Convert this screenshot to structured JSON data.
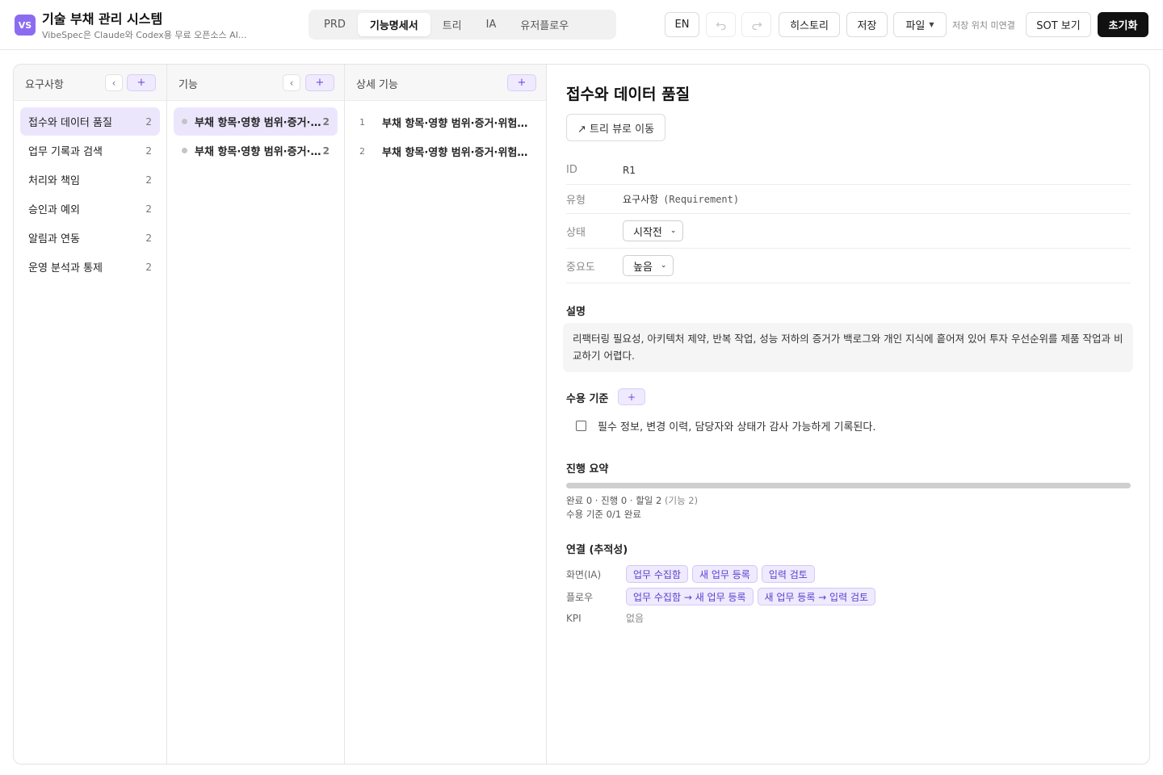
{
  "app": {
    "logo": "VS",
    "title": "기술 부채 관리 시스템",
    "subtitle": "VibeSpec은 Claude와 Codex용 무료 오픈소스 AI..."
  },
  "tabs": [
    {
      "label": "PRD",
      "active": false
    },
    {
      "label": "기능명세서",
      "active": true
    },
    {
      "label": "트리",
      "active": false
    },
    {
      "label": "IA",
      "active": false
    },
    {
      "label": "유저플로우",
      "active": false
    }
  ],
  "toolbar": {
    "lang": "EN",
    "undo_icon": "undo-icon",
    "redo_icon": "redo-icon",
    "history": "히스토리",
    "save": "저장",
    "file": "파일",
    "save_location": "저장 위치 미연결",
    "sot": "SOT 보기",
    "reset": "초기화"
  },
  "requirements": {
    "title": "요구사항",
    "collapse": "‹",
    "add": "+",
    "items": [
      {
        "label": "접수와 데이터 품질",
        "count": "2"
      },
      {
        "label": "업무 기록과 검색",
        "count": "2"
      },
      {
        "label": "처리와 책임",
        "count": "2"
      },
      {
        "label": "승인과 예외",
        "count": "2"
      },
      {
        "label": "알림과 연동",
        "count": "2"
      },
      {
        "label": "운영 분석과 통제",
        "count": "2"
      }
    ]
  },
  "features": {
    "title": "기능",
    "collapse": "‹",
    "add": "+",
    "items": [
      {
        "label": "부채 항목·영향 범위·증거·위험도 정리",
        "count": "2"
      },
      {
        "label": "부채 항목·영향 범위·증거·위험도 정리",
        "count": "2"
      }
    ]
  },
  "details": {
    "title": "상세 기능",
    "add": "+",
    "items": [
      {
        "num": "1",
        "label": "부채 항목·영향 범위·증거·위험도 정리"
      },
      {
        "num": "2",
        "label": "부채 항목·영향 범위·증거·위험도 정리"
      }
    ]
  },
  "detail": {
    "title": "접수와 데이터 품질",
    "tree_link": "↗ 트리 뷰로 이동",
    "props": {
      "id_key": "ID",
      "id_val": "R1",
      "type_key": "유형",
      "type_val": "요구사항",
      "type_en": "(Requirement)",
      "status_key": "상태",
      "status_val": "시작전",
      "priority_key": "중요도",
      "priority_val": "높음"
    },
    "desc_title": "설명",
    "desc": "리팩터링 필요성, 아키텍처 제약, 반복 작업, 성능 저하의 증거가 백로그와 개인 지식에 흩어져 있어 투자 우선순위를 제품 작업과 비교하기 어렵다.",
    "acceptance_title": "수용 기준",
    "acceptance_add": "+",
    "acceptance_items": [
      {
        "text": "필수 정보, 변경 이력, 담당자와 상태가 감사 가능하게 기록된다.",
        "checked": false
      }
    ],
    "progress_title": "진행 요약",
    "progress_fraction": 0,
    "progress_line1": "완료 0 · 진행 0 · 할일 2",
    "progress_line1_muted": "(기능 2)",
    "progress_line2": "수용 기준 0/1 완료",
    "links_title": "연결 (추적성)",
    "links": {
      "screens_key": "화면(IA)",
      "screens": [
        "업무 수집함",
        "새 업무 등록",
        "입력 검토"
      ],
      "flows_key": "플로우",
      "flows": [
        "업무 수집함 → 새 업무 등록",
        "새 업무 등록 → 입력 검토"
      ],
      "kpi_key": "KPI",
      "kpi_val": "없음"
    }
  },
  "colors": {
    "accent": "#8b6cf0",
    "selected_bg": "#ece6fd",
    "chip_bg": "#efeafd"
  }
}
